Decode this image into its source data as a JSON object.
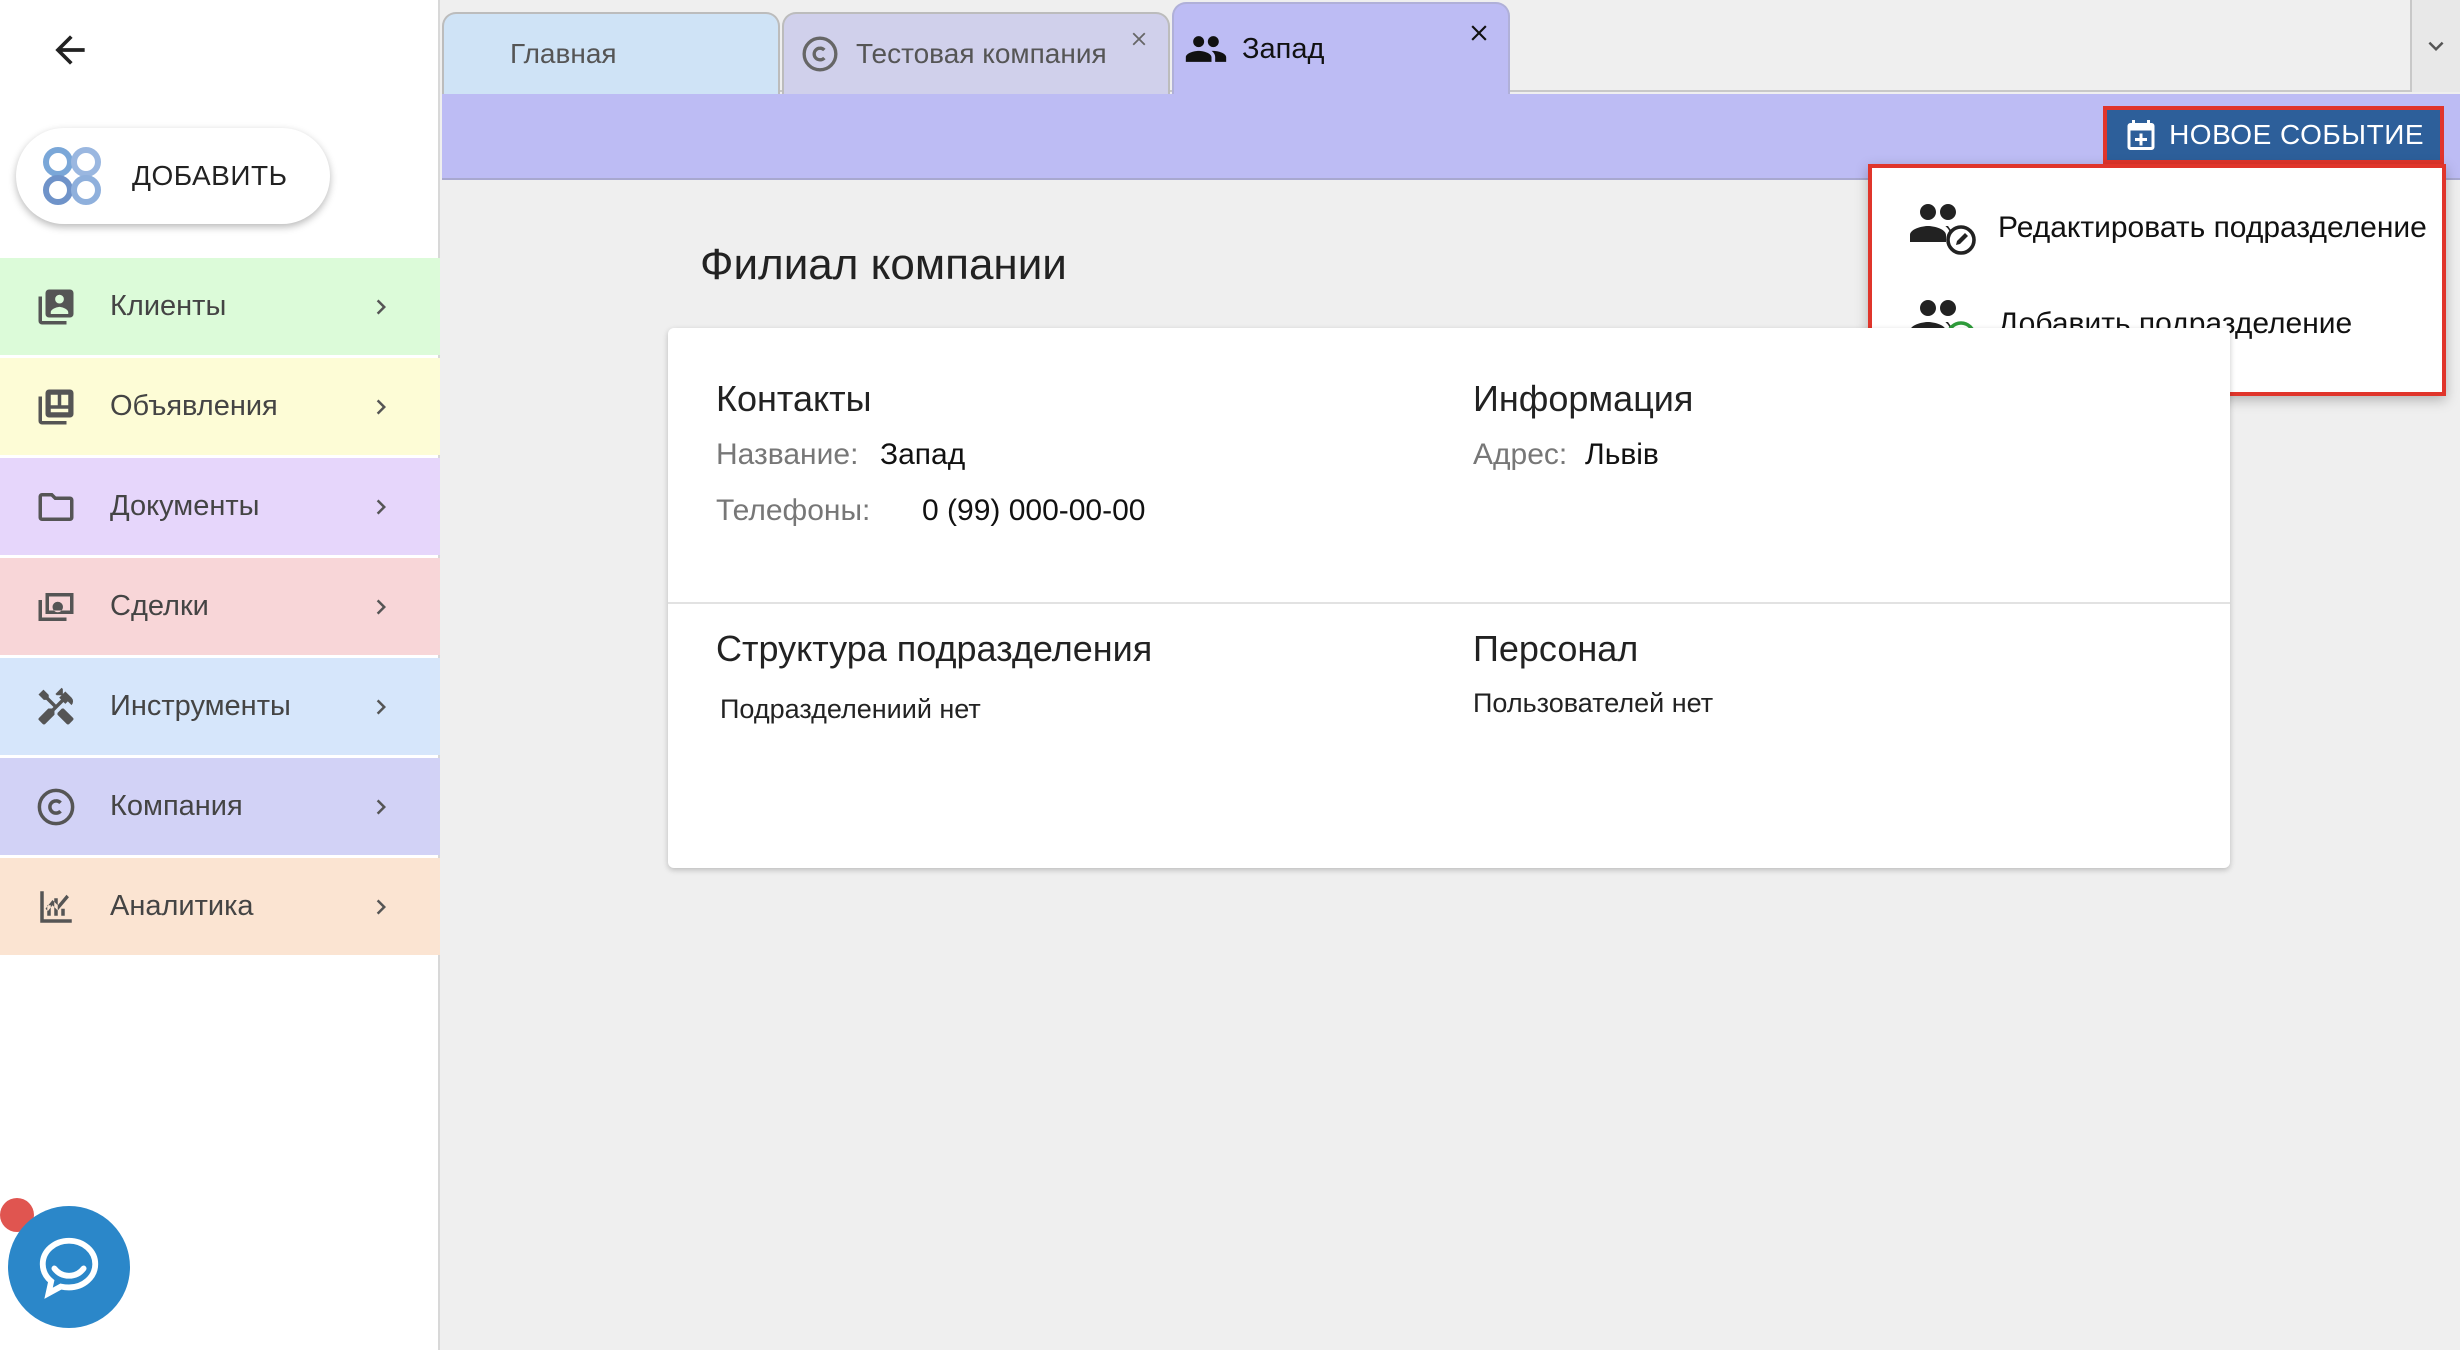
{
  "sidebar": {
    "add_button_label": "ДОБАВИТЬ",
    "items": [
      {
        "label": "Клиенты",
        "icon": "contacts-icon",
        "bg": "#dcfbd9"
      },
      {
        "label": "Объявления",
        "icon": "listings-icon",
        "bg": "#fdfcd6"
      },
      {
        "label": "Документы",
        "icon": "folder-icon",
        "bg": "#e6d6fb"
      },
      {
        "label": "Сделки",
        "icon": "money-icon",
        "bg": "#f8d6d8"
      },
      {
        "label": "Инструменты",
        "icon": "tools-icon",
        "bg": "#d6e6fb"
      },
      {
        "label": "Компания",
        "icon": "copyright-icon",
        "bg": "#d2d2f6"
      },
      {
        "label": "Аналитика",
        "icon": "analytics-icon",
        "bg": "#fbe4d2"
      }
    ]
  },
  "tabs": [
    {
      "label": "Главная"
    },
    {
      "label": "Тестовая компания"
    },
    {
      "label": "Запад"
    }
  ],
  "toolbar": {
    "new_event_label": "НОВОЕ СОБЫТИЕ"
  },
  "menu": {
    "items": [
      {
        "label": "Редактировать подразделение",
        "icon": "group-edit-icon"
      },
      {
        "label": "Добавить подразделение",
        "icon": "group-add-icon"
      }
    ]
  },
  "main": {
    "title": "Филиал компании",
    "contacts": {
      "heading": "Контакты",
      "name_label": "Название:",
      "name_value": "Запад",
      "phones_label": "Телефоны:",
      "phones_value": "0 (99) 000-00-00"
    },
    "info": {
      "heading": "Информация",
      "address_label": "Адрес:",
      "address_value": "Львів"
    },
    "structure": {
      "heading": "Структура подразделения",
      "empty_text": "Подразделениий нет"
    },
    "staff": {
      "heading": "Персонал",
      "empty_text": "Пользователей нет"
    }
  },
  "colors": {
    "accent": "#bdbcf4",
    "primary_button": "#2d5f9a",
    "highlight_border": "#e0352b",
    "chat_button": "#2b87c9"
  }
}
